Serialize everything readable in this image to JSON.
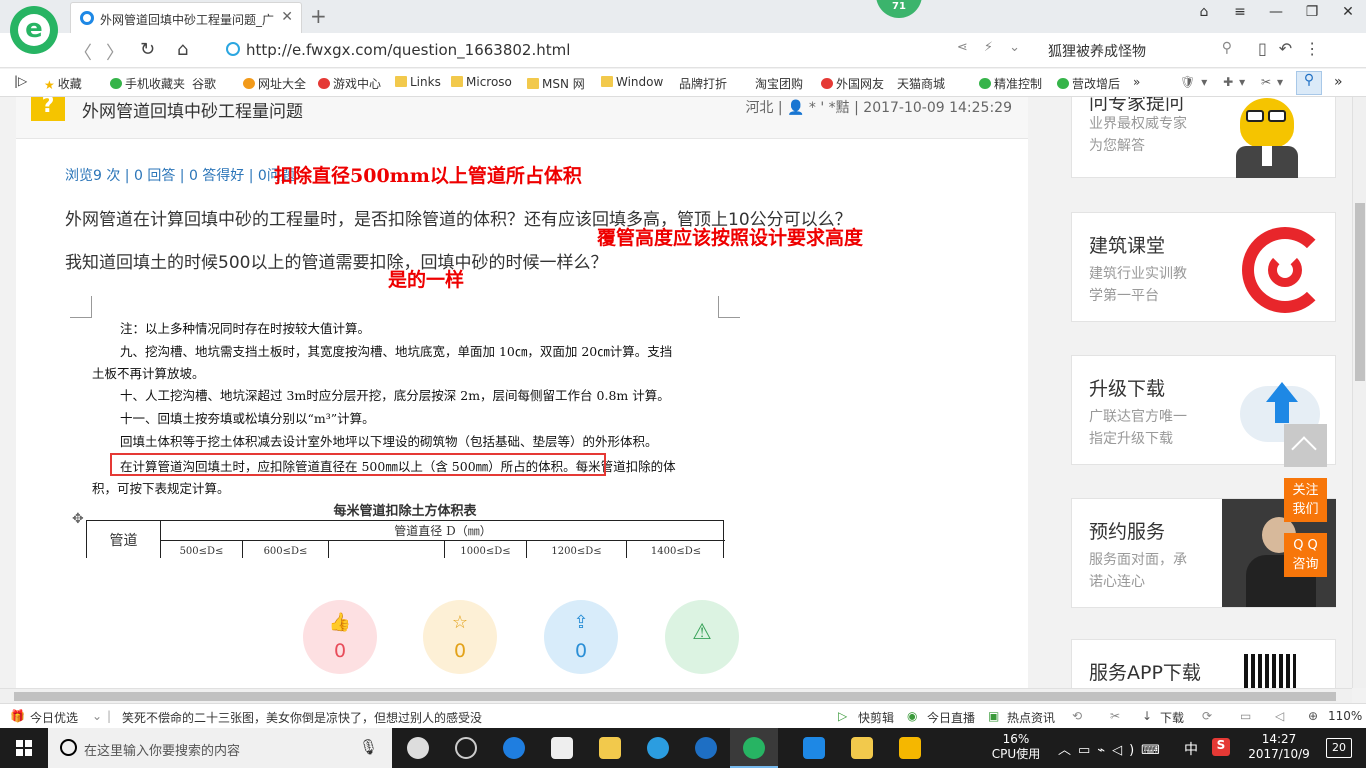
{
  "browser": {
    "logo_letter": "e",
    "tab_title": "外网管道回填中砂工程量问题_广",
    "tab_close": "✕",
    "new_tab": "+",
    "badge": "71",
    "url": "http://e.fwxgx.com/question_1663802.html",
    "search_text": "狐狸被养成怪物"
  },
  "bookmarks": [
    {
      "label": "收藏",
      "icon": "star"
    },
    {
      "label": "手机收藏夹",
      "icon": "green"
    },
    {
      "label": "谷歌",
      "icon": "page"
    },
    {
      "label": "网址大全",
      "icon": "orange"
    },
    {
      "label": "游戏中心",
      "icon": "red"
    },
    {
      "label": "Links",
      "icon": "folder"
    },
    {
      "label": "Microso",
      "icon": "folder"
    },
    {
      "label": "MSN 网",
      "icon": "folder"
    },
    {
      "label": "Window",
      "icon": "folder"
    },
    {
      "label": "品牌打折",
      "icon": "page"
    },
    {
      "label": "淘宝团购",
      "icon": "page"
    },
    {
      "label": "外国网友",
      "icon": "red"
    },
    {
      "label": "天猫商城",
      "icon": "page"
    },
    {
      "label": "精准控制",
      "icon": "green"
    },
    {
      "label": "营改增后",
      "icon": "green"
    },
    {
      "label": "»",
      "icon": ""
    }
  ],
  "question": {
    "title": "外网管道回填中砂工程量问题",
    "meta": "河北 | 👤 * ' *黠 | 2017-10-09 14:25:29",
    "stats": "浏览9 次 | 0 回答 | 0 答得好 | 0问题",
    "line1": "外网管道在计算回填中砂的工程量时，是否扣除管道的体积？还有应该回填多高，管顶上10公分可以么？",
    "line2": "我知道回填土的时候500以上的管道需要扣除，回填中砂的时候一样么？"
  },
  "annotations": {
    "a1": "扣除直径500mm以上管道所占体积",
    "a2": "覆管高度应该按照设计要求高度",
    "a3": "是的一样"
  },
  "document": {
    "lines": [
      "注：以上多种情况同时存在时按较大值计算。",
      "九、挖沟槽、地坑需支挡土板时，其宽度按沟槽、地坑底宽，单面加 10㎝，双面加 20㎝计算。支挡",
      "土板不再计算放坡。",
      "十、人工挖沟槽、地坑深超过 3m时应分层开挖，底分层按深 2m，层间每侧留工作台 0.8m 计算。",
      "十一、回填土按夯填或松填分别以“m³”计算。",
      "回填土体积等于挖土体积减去设计室外地坪以下埋设的砌筑物（包括基础、垫层等）的外形体积。",
      "在计算管道沟回填土时，应扣除管道直径在 500㎜以上（含 500㎜）所占的体积。每米管道扣除的体",
      "积，可按下表规定计算。"
    ],
    "table_title": "每米管道扣除土方体积表",
    "table_col1": "管道",
    "table_header": "管道直径 D（㎜）",
    "table_sub": [
      "500≤D≤",
      "600≤D≤",
      "",
      "1000≤D≤",
      "1200≤D≤",
      "1400≤D≤"
    ]
  },
  "actions": [
    {
      "icon": "👍",
      "count": "0",
      "color": "#e84c5a"
    },
    {
      "icon": "☆",
      "count": "0",
      "color": "#e3a21a"
    },
    {
      "icon": "⇪",
      "count": "0",
      "color": "#2b8fd6"
    },
    {
      "icon": "⚠",
      "count": "",
      "color": "#3aa35a"
    }
  ],
  "sidebar": {
    "ask": {
      "title": "问专家提问",
      "desc1": "业界最权威专家",
      "desc2": "为您解答"
    },
    "course": {
      "title": "建筑课堂",
      "desc1": "建筑行业实训教",
      "desc2": "学第一平台"
    },
    "upgrade": {
      "title": "升级下载",
      "desc1": "广联达官方唯一",
      "desc2": "指定升级下载"
    },
    "service": {
      "title": "预约服务",
      "desc1": "服务面对面，承",
      "desc2": "诺心连心"
    },
    "app": {
      "title": "服务APP下载"
    }
  },
  "float_buttons": {
    "follow": [
      "关注",
      "我们"
    ],
    "qq": [
      "Q Q",
      "咨询"
    ]
  },
  "statusbar": {
    "today": "今日优选",
    "news": "笑死不偿命的二十三张图，美女你倒是凉快了，但想过别人的感受没",
    "quickcut": "快剪辑",
    "live": "今日直播",
    "hot": "热点资讯",
    "download": "下载",
    "zoom": "110%"
  },
  "taskbar": {
    "search_placeholder": "在这里输入你要搜索的内容",
    "cpu_pct": "16%",
    "cpu_label": "CPU使用",
    "ime": "中",
    "time": "14:27",
    "date": "2017/10/9",
    "notif": "20"
  },
  "colors": {
    "brand_green": "#27b463",
    "link_blue": "#2b75b8",
    "annotation_red": "#e00000",
    "float_orange": "#f7760a"
  }
}
